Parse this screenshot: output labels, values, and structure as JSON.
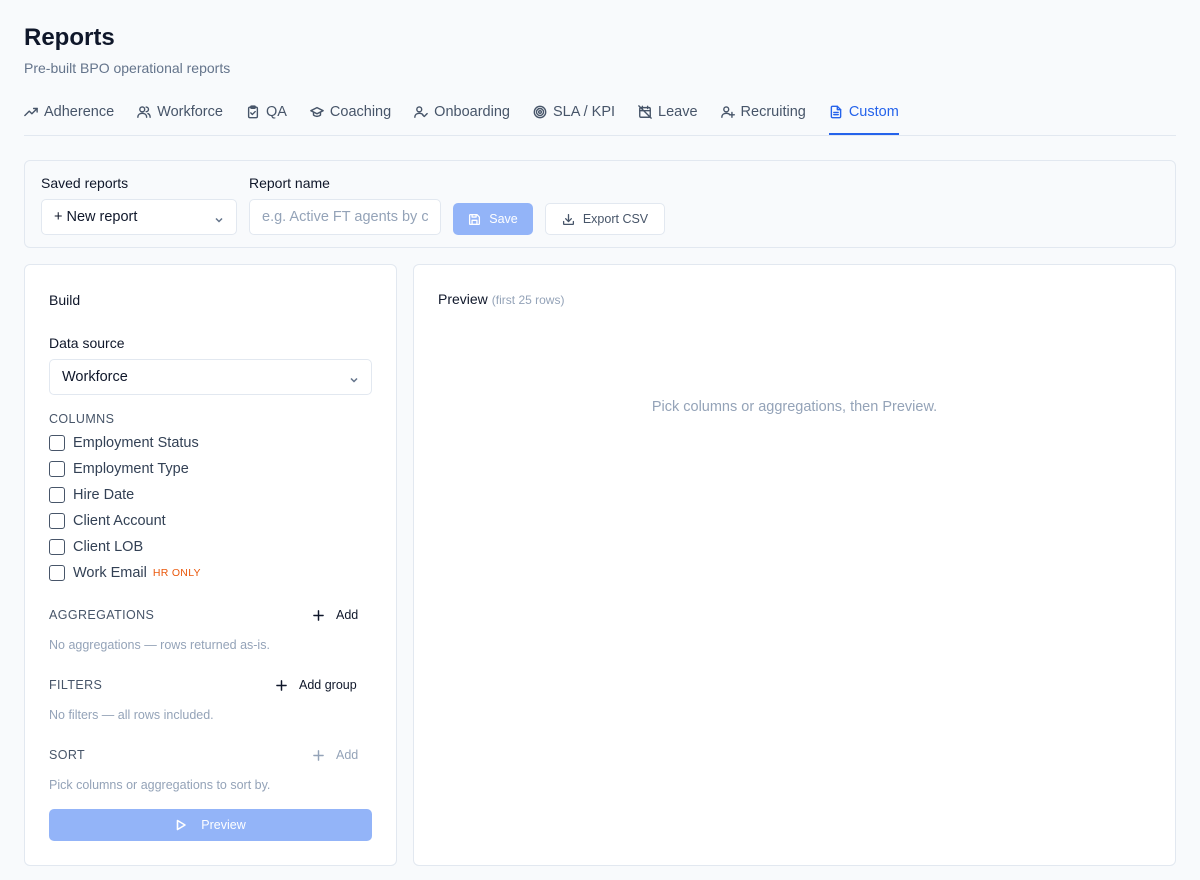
{
  "header": {
    "title": "Reports",
    "subtitle": "Pre-built BPO operational reports"
  },
  "tabs": [
    {
      "label": "Adherence",
      "icon": "trend-up-icon"
    },
    {
      "label": "Workforce",
      "icon": "users-icon"
    },
    {
      "label": "QA",
      "icon": "clipboard-check-icon"
    },
    {
      "label": "Coaching",
      "icon": "graduation-cap-icon"
    },
    {
      "label": "Onboarding",
      "icon": "user-check-icon"
    },
    {
      "label": "SLA / KPI",
      "icon": "target-icon"
    },
    {
      "label": "Leave",
      "icon": "calendar-off-icon"
    },
    {
      "label": "Recruiting",
      "icon": "user-plus-icon"
    },
    {
      "label": "Custom",
      "icon": "file-text-icon",
      "active": true
    }
  ],
  "toolbar": {
    "saved_reports_label": "Saved reports",
    "saved_reports_value": "+ New report",
    "report_name_label": "Report name",
    "report_name_placeholder": "e.g. Active FT agents by client",
    "save_label": "Save",
    "export_label": "Export CSV"
  },
  "build": {
    "title": "Build",
    "data_source_label": "Data source",
    "data_source_value": "Workforce",
    "columns_label": "COLUMNS",
    "columns": [
      {
        "label": "Employment Status",
        "checked": false
      },
      {
        "label": "Employment Type",
        "checked": false
      },
      {
        "label": "Hire Date",
        "checked": false
      },
      {
        "label": "Client Account",
        "checked": false
      },
      {
        "label": "Client LOB",
        "checked": false
      },
      {
        "label": "Work Email",
        "checked": false,
        "badge": "HR ONLY"
      }
    ],
    "aggregations_label": "AGGREGATIONS",
    "aggregations_add": "Add",
    "aggregations_empty": "No aggregations — rows returned as-is.",
    "filters_label": "FILTERS",
    "filters_add": "Add group",
    "filters_empty": "No filters — all rows included.",
    "sort_label": "SORT",
    "sort_add": "Add",
    "sort_empty": "Pick columns or aggregations to sort by.",
    "preview_button": "Preview"
  },
  "preview": {
    "title": "Preview",
    "subtitle": "(first 25 rows)",
    "empty": "Pick columns or aggregations, then Preview."
  },
  "colors": {
    "accent": "#2563eb",
    "disabled_button": "#93b4f8",
    "badge": "#ea580c"
  }
}
